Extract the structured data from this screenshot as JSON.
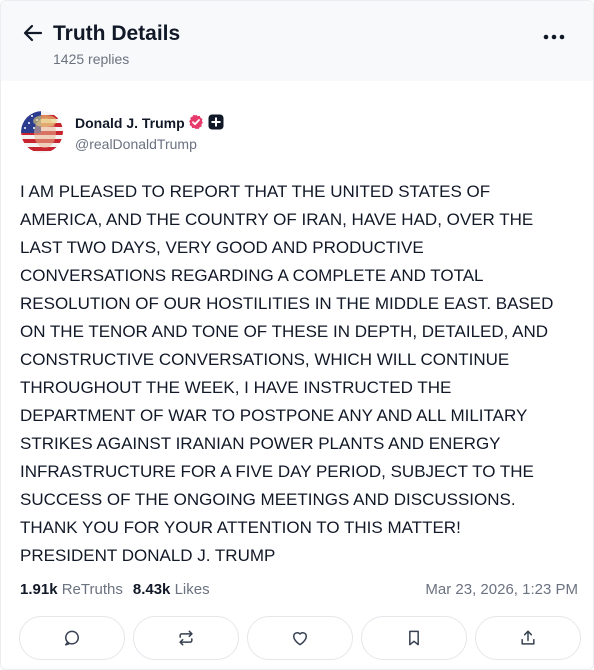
{
  "header": {
    "title": "Truth Details",
    "subtitle": "1425 replies"
  },
  "author": {
    "name": "Donald J. Trump",
    "handle": "@realDonaldTrump"
  },
  "post": {
    "text": "I AM PLEASED TO REPORT THAT THE UNITED STATES OF\nAMERICA, AND THE COUNTRY OF IRAN, HAVE HAD, OVER THE\nLAST TWO DAYS, VERY GOOD AND PRODUCTIVE\nCONVERSATIONS REGARDING A COMPLETE AND TOTAL\nRESOLUTION OF OUR HOSTILITIES IN THE MIDDLE EAST. BASED\nON THE TENOR AND TONE OF THESE IN DEPTH, DETAILED, AND\nCONSTRUCTIVE CONVERSATIONS, WHICH WILL CONTINUE\nTHROUGHOUT THE WEEK, I HAVE INSTRUCTED THE\nDEPARTMENT OF WAR TO POSTPONE ANY AND ALL MILITARY\nSTRIKES AGAINST IRANIAN POWER PLANTS AND ENERGY\nINFRASTRUCTURE FOR A FIVE DAY PERIOD, SUBJECT TO THE\nSUCCESS OF THE ONGOING MEETINGS AND DISCUSSIONS.\nTHANK YOU FOR YOUR ATTENTION TO THIS MATTER!\nPRESIDENT DONALD J. TRUMP"
  },
  "stats": {
    "retruths_count": "1.91k",
    "retruths_label": "ReTruths",
    "likes_count": "8.43k",
    "likes_label": "Likes",
    "timestamp": "Mar 23, 2026, 1:23 PM"
  },
  "actions": [
    {
      "icon": "comment-icon"
    },
    {
      "icon": "retruth-icon"
    },
    {
      "icon": "heart-icon"
    },
    {
      "icon": "bookmark-icon"
    },
    {
      "icon": "share-icon"
    }
  ],
  "colors": {
    "header_bg": "#f8f9fa",
    "verified_badge": "#e8396b",
    "text_primary": "#111827",
    "text_secondary": "#6b7280"
  }
}
